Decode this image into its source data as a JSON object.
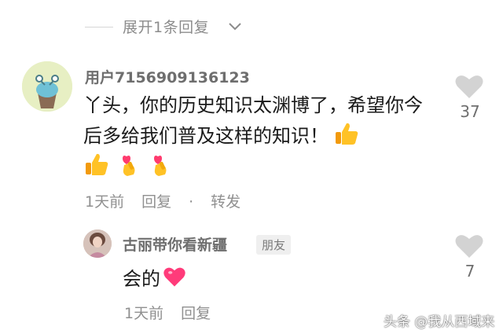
{
  "expand": {
    "label": "展开1条回复",
    "icon": "chevron-down-icon"
  },
  "comment": {
    "username": "用户7156909136123",
    "text": "丫头，你的历史知识太渊博了，希望你今后多给我们普及这样的知识！",
    "inline_emoji": "thumbs-up-icon",
    "emojis": [
      "thumbs-up-icon",
      "finger-heart-icon",
      "finger-heart-icon"
    ],
    "time": "1天前",
    "reply_label": "回复",
    "separator": "·",
    "share_label": "转发",
    "like_count": "37"
  },
  "reply": {
    "username": "古丽带你看新疆",
    "badge": "朋友",
    "text": "会的",
    "emoji": "heart-icon",
    "time": "1天前",
    "reply_label": "回复",
    "like_count": "7"
  },
  "watermark": "头条 @我从西域来",
  "colors": {
    "like_icon": "#d3d3d3",
    "meta_text": "#909090",
    "heart": "#ff3b7a",
    "thumb": "#f7b500"
  }
}
